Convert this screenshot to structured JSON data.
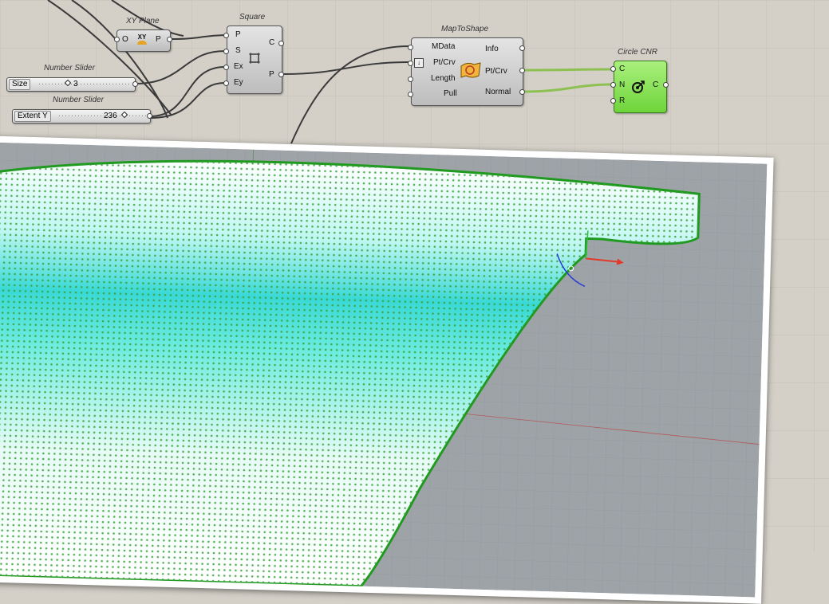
{
  "components": {
    "xy_plane": {
      "title": "XY Plane",
      "input": "O",
      "output": "P",
      "icon": "xy-plane-icon",
      "icon_text": "XY"
    },
    "square": {
      "title": "Square",
      "inputs": [
        "P",
        "S",
        "Ex",
        "Ey"
      ],
      "outputs": [
        "C",
        "P"
      ],
      "icon": "square-grid-icon"
    },
    "map_to_shape": {
      "title": "MapToShape",
      "inputs": [
        "MData",
        "Pt/Crv",
        "Length",
        "Pull"
      ],
      "outputs": [
        "Info",
        "Pt/Crv",
        "Normal"
      ],
      "icon": "surface-map-icon"
    },
    "circle_cnr": {
      "title": "Circle CNR",
      "inputs": [
        "C",
        "N",
        "R"
      ],
      "output": "C",
      "icon": "circle-target-icon"
    }
  },
  "sliders": [
    {
      "title": "Number Slider",
      "label": "Size",
      "value": "3"
    },
    {
      "title": "Number Slider",
      "label": "Extent Y",
      "value": "236"
    }
  ],
  "colors": {
    "canvas": "#d4d0c8",
    "wire_default": "#3a3a3a",
    "wire_selected": "#8cc152",
    "component_green": "#7ddc49",
    "surface_cyan": "#4fe3dc",
    "dot_green": "#3aa03a",
    "viewport_grey": "#9ea3a8"
  }
}
